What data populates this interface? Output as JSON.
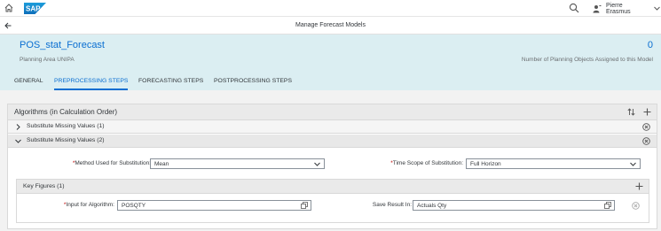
{
  "shell": {
    "user_name": "Pierre Erasmus"
  },
  "app": {
    "title": "Manage Forecast Models"
  },
  "header": {
    "title": "POS_stat_Forecast",
    "subtitle": "Planning Area UNIPA",
    "count": "0",
    "count_label": "Number of Planning Objects Assigned to this Model"
  },
  "tabs": [
    {
      "label": "GENERAL"
    },
    {
      "label": "PREPROCESSING STEPS",
      "active": true
    },
    {
      "label": "FORECASTING STEPS"
    },
    {
      "label": "POSTPROCESSING STEPS"
    }
  ],
  "algorithms": {
    "title": "Algorithms (in Calculation Order)",
    "items": [
      {
        "label": "Substitute Missing Values (1)"
      },
      {
        "label": "Substitute Missing Values (2)"
      }
    ]
  },
  "form": {
    "method_label": "Method Used for Substitution:",
    "method_value": "Mean",
    "scope_label": "Time Scope of Substitution:",
    "scope_value": "Full Horizon"
  },
  "key_figures": {
    "title": "Key Figures (1)",
    "input_label": "Input for Algorithm:",
    "input_value": "POSQTY",
    "save_label": "Save Result In:",
    "save_value": "Actuals Qty"
  },
  "colors": {
    "accent": "#0a6ed1",
    "header_bg": "#dbeef2",
    "required": "#bb0000"
  }
}
